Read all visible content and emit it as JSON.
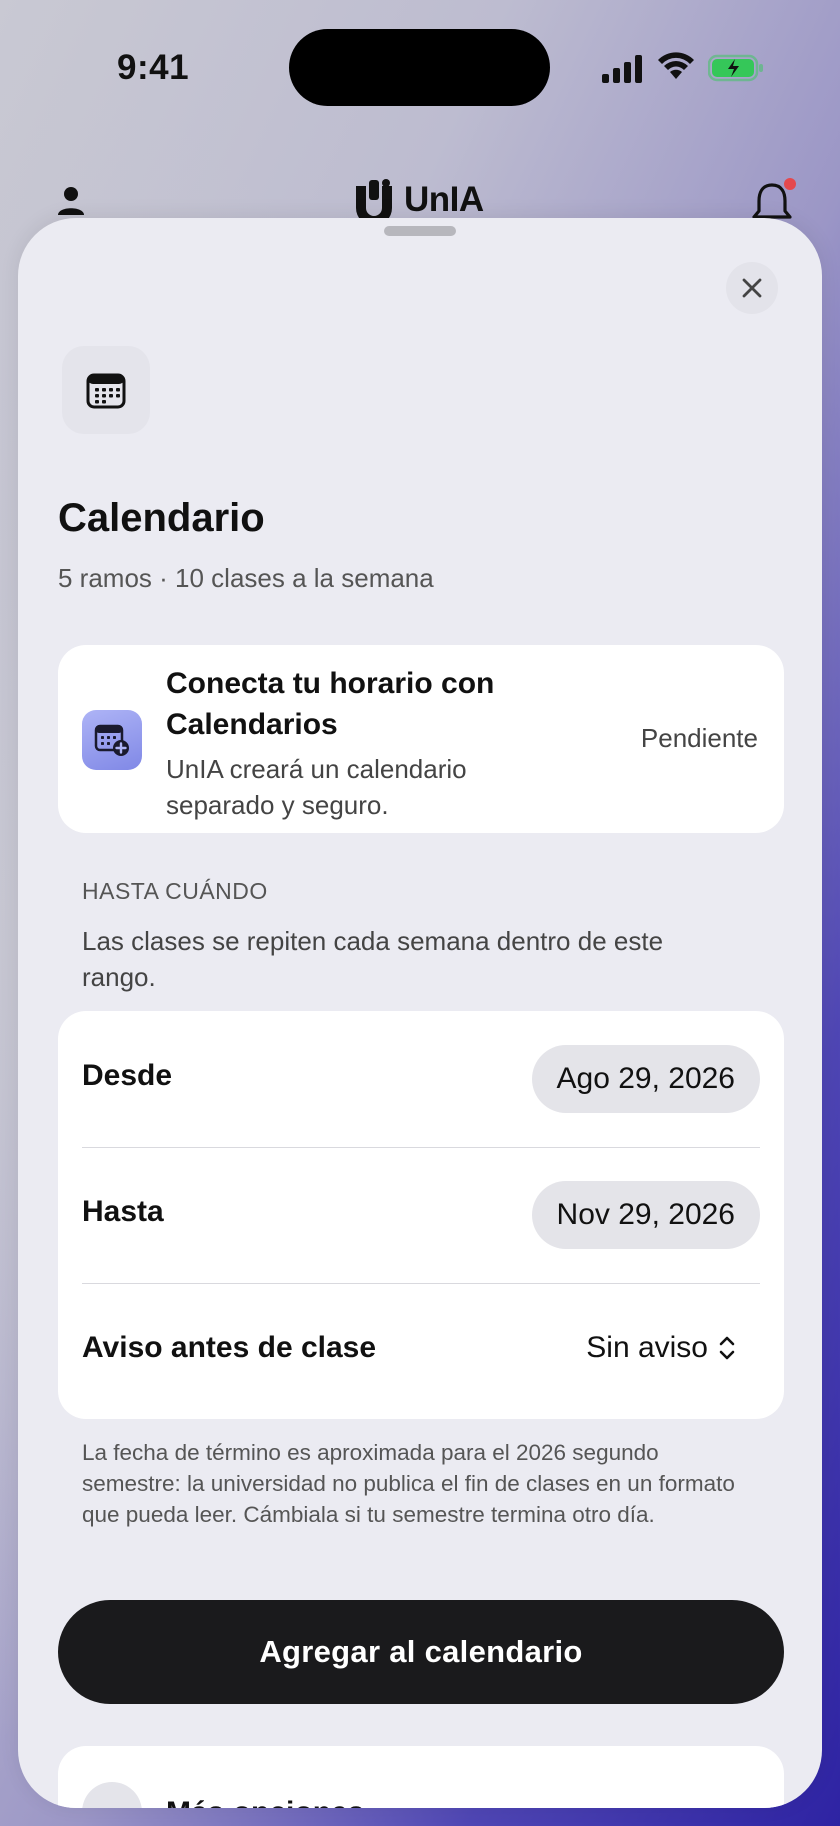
{
  "status_bar": {
    "time": "9:41",
    "icons": [
      "cellular-signal-icon",
      "wifi-icon",
      "battery-charging-icon"
    ],
    "battery_color": "#35c759"
  },
  "app_header": {
    "logo_text": "UnIA",
    "icons": [
      "profile-icon",
      "unia-logo-icon",
      "bell-icon"
    ],
    "notification_dot_color": "#e5484d"
  },
  "sheet": {
    "close_icon": "close-icon",
    "header_icon": "calendar-icon",
    "title": "Calendario",
    "subtitle": "5 ramos · 10 clases a la semana",
    "connect": {
      "icon": "calendar-add-icon",
      "title": "Conecta tu horario con Calendarios",
      "description": "UnIA creará un calendario separado y seguro.",
      "status": "Pendiente"
    },
    "range_section": {
      "label": "HASTA CUÁNDO",
      "description": "Las clases se repiten cada semana dentro de este rango."
    },
    "form": {
      "from_label": "Desde",
      "from_value": "Ago 29, 2026",
      "to_label": "Hasta",
      "to_value": "Nov 29, 2026",
      "reminder_label": "Aviso antes de clase",
      "reminder_value": "Sin aviso"
    },
    "footnote": "La fecha de término es aproximada para el 2026 segundo semestre: la universidad no publica el fin de clases en un formato que pueda leer. Cámbiala si tu semestre termina otro día.",
    "primary_button": "Agregar al calendario",
    "more_options_label": "Más opciones"
  },
  "colors": {
    "accent_gradient_start": "#aeb4f6",
    "accent_gradient_end": "#8088e6",
    "button_dark": "#1a1a1c",
    "sheet_background": "#ebebf2"
  }
}
